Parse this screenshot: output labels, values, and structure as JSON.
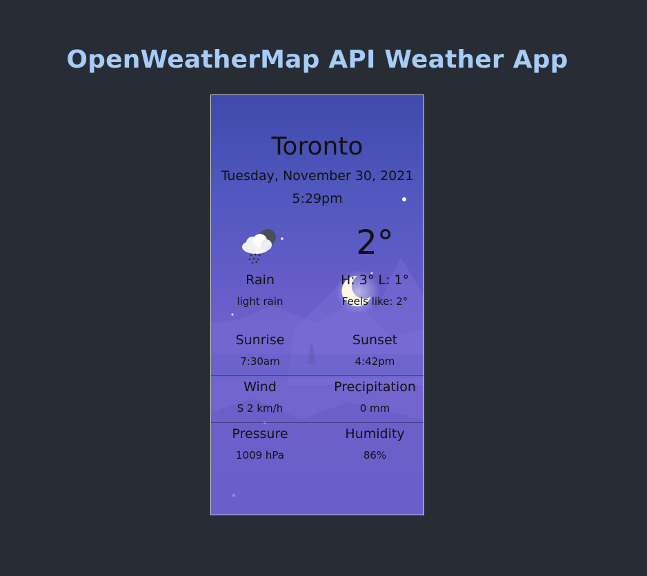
{
  "app": {
    "title": "OpenWeatherMap API Weather App"
  },
  "weather": {
    "city": "Toronto",
    "date": "Tuesday, November 30, 2021",
    "time": "5:29pm",
    "icon": "cloud-rain-night-icon",
    "condition": "Rain",
    "description": "light rain",
    "temperature": "2°",
    "high_low": "H: 3° L: 1°",
    "feels_like": "Feels like: 2°"
  },
  "details": {
    "sunrise": {
      "label": "Sunrise",
      "value": "7:30am"
    },
    "sunset": {
      "label": "Sunset",
      "value": "4:42pm"
    },
    "wind": {
      "label": "Wind",
      "value": "S 2 km/h"
    },
    "precipitation": {
      "label": "Precipitation",
      "value": "0 mm"
    },
    "pressure": {
      "label": "Pressure",
      "value": "1009 hPa"
    },
    "humidity": {
      "label": "Humidity",
      "value": "86%"
    }
  },
  "colors": {
    "page_background": "#282c34",
    "title": "#a6ccf7",
    "card_top": "#3f4aac",
    "card_bottom": "#6a5ccb"
  }
}
